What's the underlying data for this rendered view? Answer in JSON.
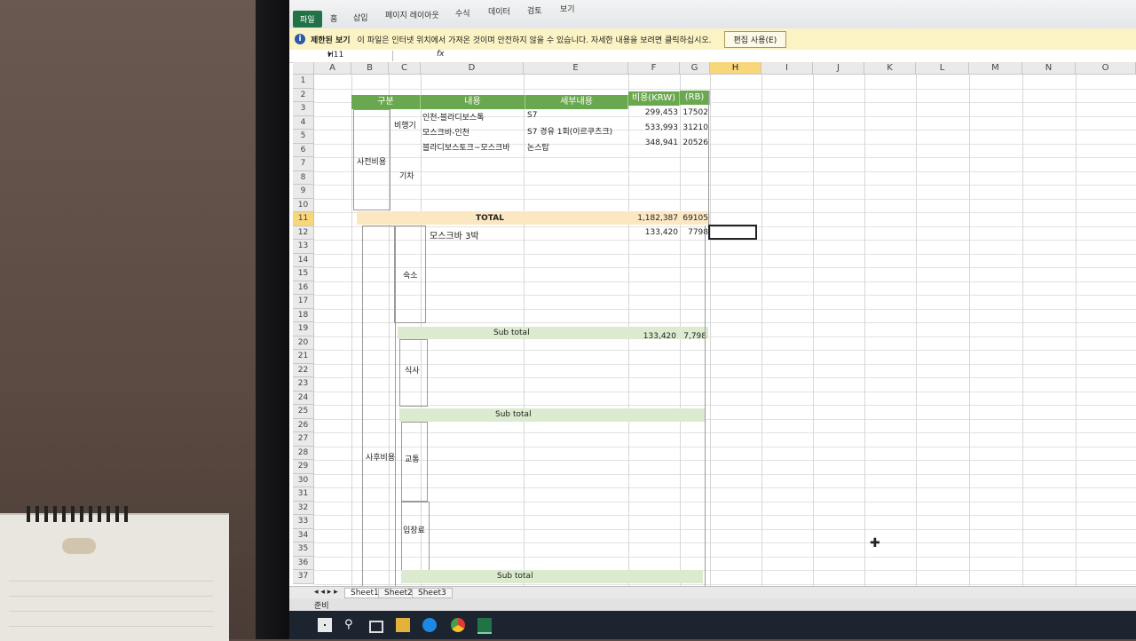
{
  "ribbon": {
    "tabs": [
      "파일",
      "홈",
      "삽입",
      "페이지 레이아웃",
      "수식",
      "데이터",
      "검토",
      "보기"
    ]
  },
  "infobar": {
    "title": "제한된 보기",
    "message": "이 파일은 인터넷 위치에서 가져온 것이며 안전하지 않을 수 있습니다. 자세한 내용을 보려면 클릭하십시오.",
    "button": "편집 사용(E)"
  },
  "formula_bar": {
    "name_box": "H11",
    "fx": "fx"
  },
  "columns": [
    "A",
    "B",
    "C",
    "D",
    "E",
    "F",
    "G",
    "H",
    "I",
    "J",
    "K",
    "L",
    "M",
    "N",
    "O"
  ],
  "rows": [
    "1",
    "2",
    "3",
    "4",
    "5",
    "6",
    "7",
    "8",
    "9",
    "10",
    "11",
    "12",
    "13",
    "14",
    "15",
    "16",
    "17",
    "18",
    "19",
    "20",
    "21",
    "22",
    "23",
    "24",
    "25",
    "26",
    "27",
    "28",
    "29",
    "30",
    "31",
    "32",
    "33",
    "34",
    "35",
    "36",
    "37"
  ],
  "table": {
    "header": {
      "category": "구분",
      "content": "내용",
      "detail": "세부내용",
      "cost_krw": "비용(KRW)",
      "cost_rb": "(RB)"
    },
    "pre_cost": "사전비용",
    "flight": "비행기",
    "train": "기차",
    "flights": [
      {
        "content": "인천-블라디보스톡",
        "detail": "S7",
        "krw": "299,453",
        "rb": "17502"
      },
      {
        "content": "모스크바-인천",
        "detail": "S7 경유 1회(이르쿠츠크)",
        "krw": "533,993",
        "rb": "31210"
      },
      {
        "content": "블라디보스토크~모스크바",
        "detail": "논스탑",
        "krw": "348,941",
        "rb": "20526"
      }
    ],
    "total_label": "TOTAL",
    "total_krw": "1,182,387",
    "total_rb": "69105",
    "post_cost": "사후비용",
    "lodging": "숙소",
    "lodging_item": {
      "content": "모스크바 3박",
      "krw": "133,420",
      "rb": "7798"
    },
    "subtotal_label": "Sub total",
    "lodging_subtotal_krw": "133,420",
    "lodging_subtotal_rb": "7,798",
    "meal": "식사",
    "transport": "교통",
    "admission": "입장료"
  },
  "sheets": [
    "Sheet1",
    "Sheet2",
    "Sheet3"
  ],
  "status": "준비"
}
